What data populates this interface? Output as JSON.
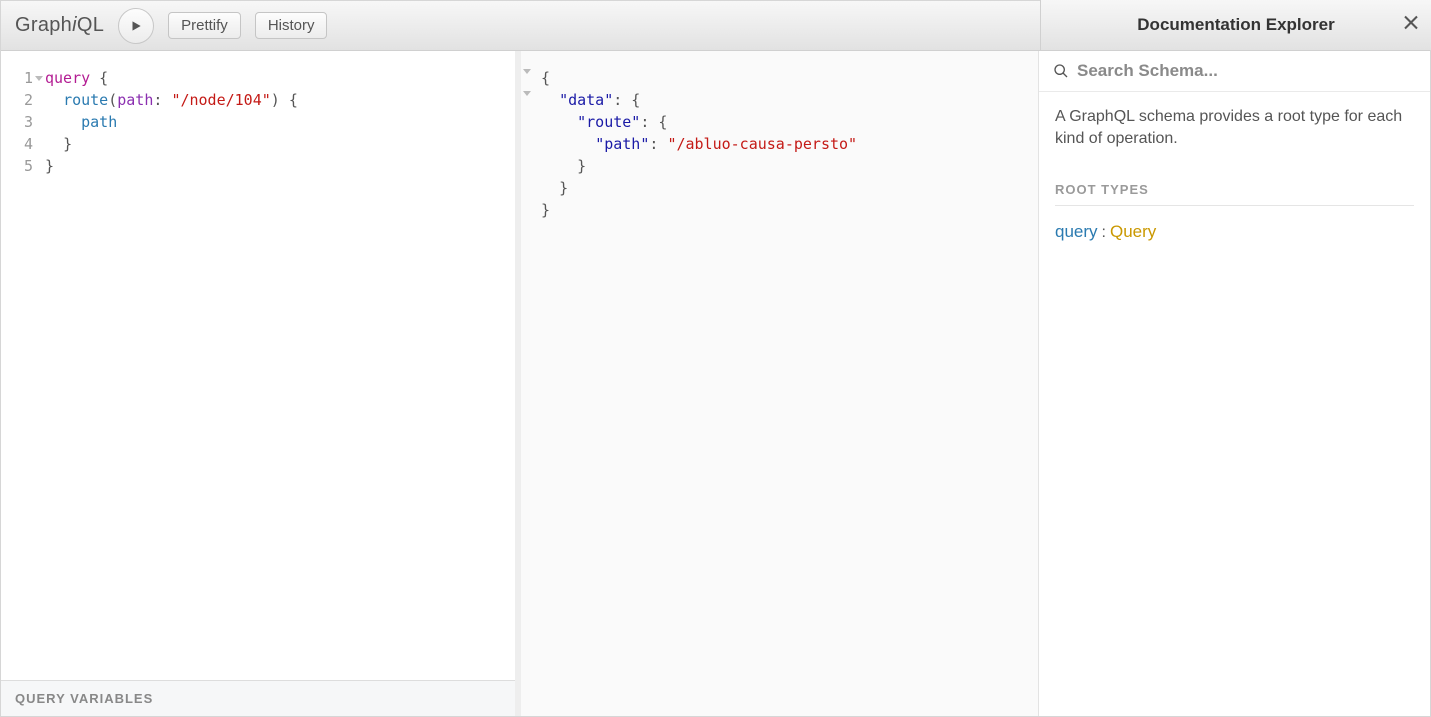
{
  "toolbar": {
    "logo_plain_left": "Graph",
    "logo_italic": "i",
    "logo_plain_right": "QL",
    "prettify_label": "Prettify",
    "history_label": "History"
  },
  "query": {
    "line_numbers": [
      "1",
      "2",
      "3",
      "4",
      "5"
    ],
    "lines": [
      {
        "tokens": [
          {
            "cls": "kw",
            "t": "query"
          },
          {
            "cls": "punc",
            "t": " {"
          }
        ]
      },
      {
        "tokens": [
          {
            "cls": "",
            "t": "  "
          },
          {
            "cls": "prop",
            "t": "route"
          },
          {
            "cls": "punc",
            "t": "("
          },
          {
            "cls": "arg",
            "t": "path"
          },
          {
            "cls": "punc",
            "t": ": "
          },
          {
            "cls": "str",
            "t": "\"/node/104\""
          },
          {
            "cls": "punc",
            "t": ") {"
          }
        ]
      },
      {
        "tokens": [
          {
            "cls": "",
            "t": "    "
          },
          {
            "cls": "prop",
            "t": "path"
          }
        ]
      },
      {
        "tokens": [
          {
            "cls": "",
            "t": "  "
          },
          {
            "cls": "punc",
            "t": "}"
          }
        ]
      },
      {
        "tokens": [
          {
            "cls": "punc",
            "t": "}"
          }
        ]
      }
    ],
    "folds": [
      true,
      false,
      false,
      false,
      false
    ]
  },
  "result": {
    "lines": [
      {
        "tokens": [
          {
            "cls": "punc",
            "t": "{"
          }
        ]
      },
      {
        "tokens": [
          {
            "cls": "",
            "t": "  "
          },
          {
            "cls": "key",
            "t": "\"data\""
          },
          {
            "cls": "punc",
            "t": ": {"
          }
        ]
      },
      {
        "tokens": [
          {
            "cls": "",
            "t": "    "
          },
          {
            "cls": "key",
            "t": "\"route\""
          },
          {
            "cls": "punc",
            "t": ": {"
          }
        ]
      },
      {
        "tokens": [
          {
            "cls": "",
            "t": "      "
          },
          {
            "cls": "key",
            "t": "\"path\""
          },
          {
            "cls": "punc",
            "t": ": "
          },
          {
            "cls": "val",
            "t": "\"/abluo-causa-persto\""
          }
        ]
      },
      {
        "tokens": [
          {
            "cls": "",
            "t": "    "
          },
          {
            "cls": "punc",
            "t": "}"
          }
        ]
      },
      {
        "tokens": [
          {
            "cls": "",
            "t": "  "
          },
          {
            "cls": "punc",
            "t": "}"
          }
        ]
      },
      {
        "tokens": [
          {
            "cls": "punc",
            "t": "}"
          }
        ]
      }
    ],
    "folds": [
      true,
      true,
      false,
      false,
      false,
      false,
      false
    ]
  },
  "variables": {
    "header_label": "QUERY VARIABLES"
  },
  "docs": {
    "title": "Documentation Explorer",
    "search_placeholder": "Search Schema...",
    "description": "A GraphQL schema provides a root type for each kind of operation.",
    "section_label": "ROOT TYPES",
    "root": {
      "field": "query",
      "type": "Query"
    }
  }
}
